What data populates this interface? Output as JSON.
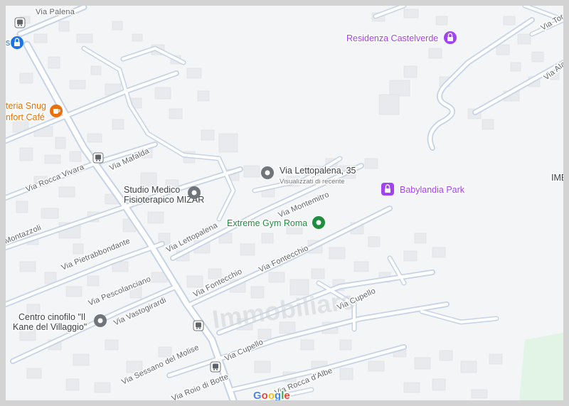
{
  "map": {
    "colors": {
      "background": "#f4f5f7",
      "road": "#ffffff",
      "road_edge": "#c5d3e4",
      "building": "#e8eaed",
      "park": "#e1f4e6",
      "pin_gray": "#70757a",
      "pin_purple": "#a142f4",
      "pin_green": "#1e8e3e",
      "pin_orange": "#e8710a",
      "pin_blue": "#1a73e8"
    },
    "streets": [
      "Via Palena",
      "Via Mafalda",
      "Via Rocca Vivara",
      "Montazzoli",
      "Via Lettopalena",
      "Via Montemitro",
      "Via Pietrabbondante",
      "Via Pescolanciano",
      "Via Fontecchio",
      "Via Fontecchio",
      "Via Vastogirardi",
      "Via Cupello",
      "Via Cupello",
      "Via Sessano del Molise",
      "Via Rocca d'Albe",
      "Via Roio di Botte",
      "Via Tor",
      "Via Alann"
    ],
    "pois": {
      "residenza": "Residenza Castelverde",
      "lettopalena_line1": "Via Lettopalena, 35",
      "lettopalena_line2": "Visualizzati di recente",
      "babylandia": "Babylandia Park",
      "studio_line1": "Studio Medico",
      "studio_line2": "Fisioterapico MIZAR",
      "gym": "Extreme Gym Roma",
      "cafe_line1": "teria Snug",
      "cafe_line2": "nfort Café",
      "cinofilo_line1": "Centro cinofilo \"Il",
      "cinofilo_line2": "Kane del Villaggio\"",
      "imb": "IMB"
    },
    "icons": [
      "bus-stop-icon",
      "lock-icon",
      "location-pin-icon",
      "cafe-icon",
      "gym-icon",
      "playground-icon"
    ],
    "watermark": "Immobiliare",
    "attribution": {
      "letters": [
        "G",
        "o",
        "o",
        "g",
        "l",
        "e"
      ],
      "colors": [
        "#4285f4",
        "#ea4335",
        "#fbbc05",
        "#4285f4",
        "#34a853",
        "#ea4335"
      ]
    }
  }
}
